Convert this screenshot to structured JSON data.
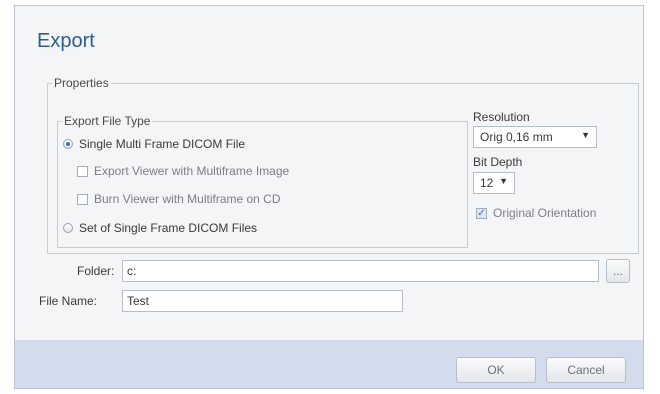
{
  "dialog": {
    "title": "Export",
    "properties_legend": "Properties",
    "export_file_type": {
      "legend": "Export File Type",
      "single_multi_frame": "Single Multi Frame DICOM File",
      "export_viewer": "Export Viewer with Multiframe Image",
      "burn_viewer": "Burn Viewer with Multiframe on CD",
      "set_single_frame": "Set of Single Frame DICOM Files"
    },
    "resolution": {
      "label": "Resolution",
      "value": "Orig 0,16 mm"
    },
    "bit_depth": {
      "label": "Bit Depth",
      "value": "12"
    },
    "original_orientation": {
      "label": "Original Orientation",
      "checked": true
    },
    "folder": {
      "label": "Folder:",
      "value": "c:",
      "browse": "..."
    },
    "file_name": {
      "label": "File Name:",
      "value": "Test"
    },
    "buttons": {
      "ok": "OK",
      "cancel": "Cancel"
    }
  }
}
